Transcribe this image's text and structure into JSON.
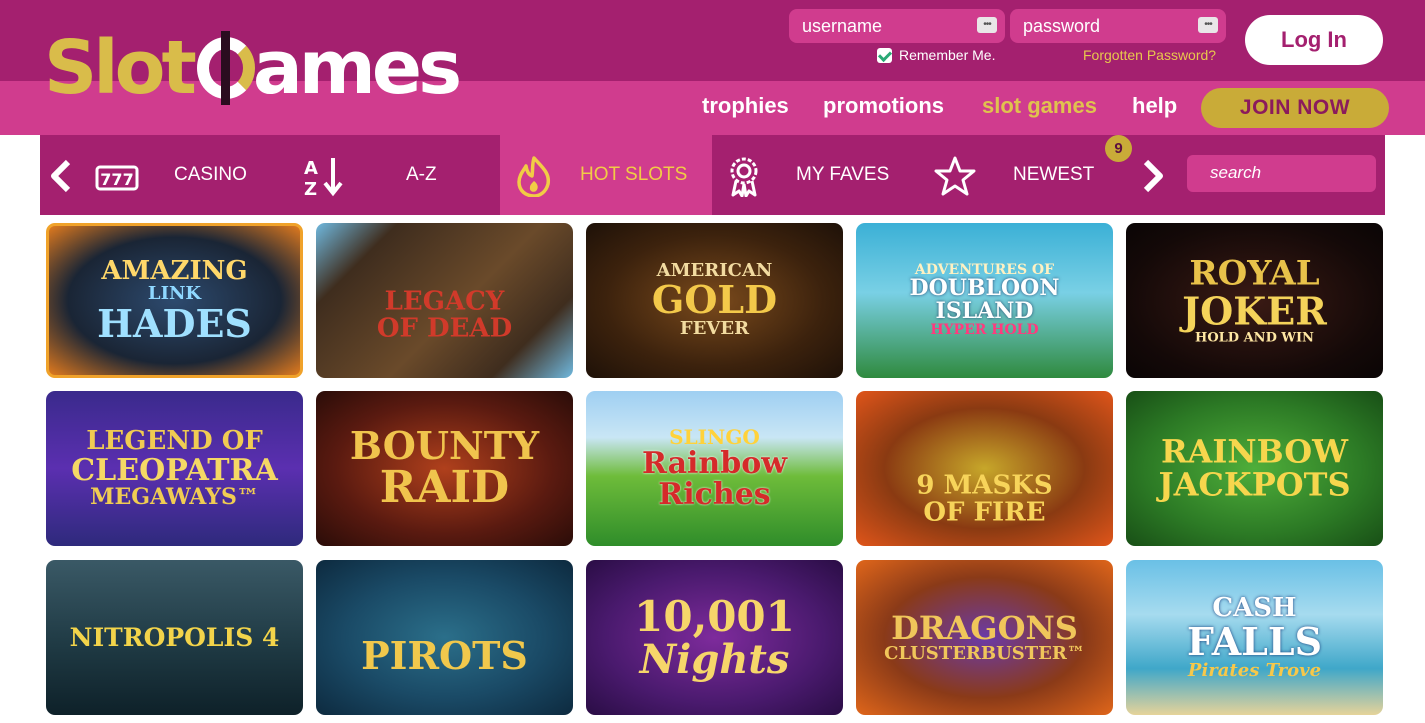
{
  "logo": {
    "part1": "Slot",
    "part2": "ames"
  },
  "login": {
    "username_placeholder": "username",
    "password_placeholder": "password",
    "remember_label": "Remember Me.",
    "forgot_label": "Forgotten Password?",
    "login_button": "Log In"
  },
  "nav": {
    "items": [
      {
        "label": "trophies"
      },
      {
        "label": "promotions"
      },
      {
        "label": "slot games"
      },
      {
        "label": "help"
      }
    ],
    "join_button": "JOIN NOW"
  },
  "categories": {
    "items": [
      {
        "label": "CASINO",
        "icon": "slot-777-icon"
      },
      {
        "label": "A-Z",
        "icon": "sort-az-icon"
      },
      {
        "label": "HOT SLOTS",
        "icon": "flame-icon"
      },
      {
        "label": "MY FAVES",
        "icon": "award-rosette-icon"
      },
      {
        "label": "NEWEST",
        "icon": "star-icon"
      }
    ],
    "active": "HOT SLOTS",
    "newest_badge": "9",
    "search_placeholder": "search"
  },
  "games": [
    {
      "line1": "AMAZING",
      "line2": "LINK",
      "line3": "HADES"
    },
    {
      "line1": "",
      "line2": "LEGACY",
      "line3": "OF DEAD"
    },
    {
      "line1": "AMERICAN",
      "line2": "GOLD",
      "line3": "FEVER"
    },
    {
      "line1": "ADVENTURES OF",
      "line2": "DOUBLOON ISLAND",
      "line3": "HYPER HOLD"
    },
    {
      "line1": "ROYAL",
      "line2": "JOKER",
      "line3": "HOLD AND WIN"
    },
    {
      "line1": "LEGEND OF",
      "line2": "CLEOPATRA",
      "line3": "MEGAWAYS™"
    },
    {
      "line1": "BOUNTY",
      "line2": "RAID",
      "line3": ""
    },
    {
      "line1": "SLINGO",
      "line2": "Rainbow",
      "line3": "Riches"
    },
    {
      "line1": "",
      "line2": "9 MASKS",
      "line3": "OF FIRE"
    },
    {
      "line1": "RAINBOW",
      "line2": "JACKPOTS",
      "line3": ""
    },
    {
      "line1": "",
      "line2": "NITROPOLIS 4",
      "line3": ""
    },
    {
      "line1": "",
      "line2": "PIROTS",
      "line3": ""
    },
    {
      "line1": "10,001",
      "line2": "Nights",
      "line3": ""
    },
    {
      "line1": "DRAGONS",
      "line2": "CLUSTERBUSTER™",
      "line3": ""
    },
    {
      "line1": "CASH",
      "line2": "FALLS",
      "line3": "Pirates Trove"
    }
  ],
  "colors": {
    "header_dark": "#a4206f",
    "header_light": "#d03c8e",
    "gold": "#c9ab38"
  }
}
